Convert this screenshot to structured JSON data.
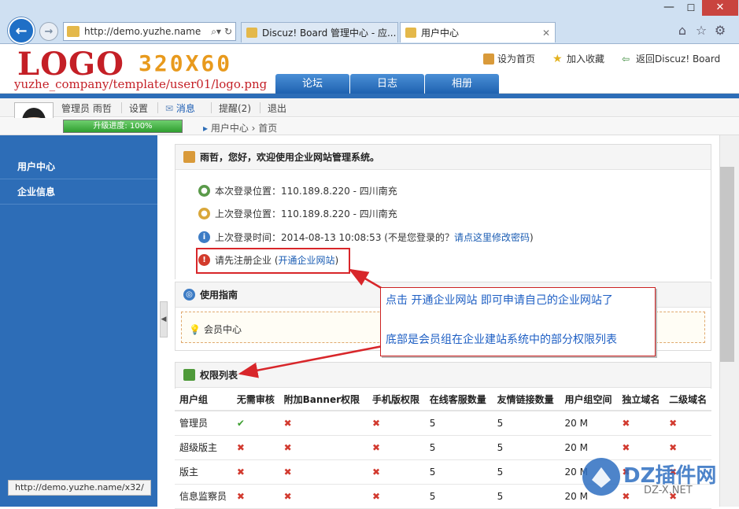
{
  "browser": {
    "url": "http://demo.yuzhe.name",
    "tabs": [
      {
        "label": "Discuz! Board 管理中心 - 应..."
      },
      {
        "label": "用户中心"
      }
    ]
  },
  "header": {
    "logo_text": "LOGO",
    "logo_size": "320X60",
    "logo_path": "yuzhe_company/template/user01/logo.png",
    "links": [
      "设为首页",
      "加入收藏",
      "返回Discuz! Board"
    ],
    "nav": [
      "论坛",
      "日志",
      "相册"
    ]
  },
  "userbar": {
    "name": "管理员 雨哲",
    "items": [
      "设置",
      "消息",
      "提醒(2)",
      "退出"
    ],
    "progress_label": "升级进度: 100%",
    "progress_value": 100
  },
  "breadcrumb": "用户中心 › 首页",
  "sidebar": {
    "items": [
      {
        "label": "用户中心"
      },
      {
        "label": "企业信息"
      }
    ]
  },
  "welcome": {
    "title": "雨哲，您好，欢迎使用企业网站管理系统。",
    "rows": [
      {
        "text": "本次登录位置：110.189.8.220 - 四川南充"
      },
      {
        "text": "上次登录位置：110.189.8.220 - 四川南充"
      },
      {
        "text": "上次登录时间：2014-08-13 10:08:53 (不是您登录的？",
        "link": "请点这里修改密码",
        "tail": ")"
      },
      {
        "text": "请先注册企业 (",
        "link": "开通企业网站",
        "tail": ")"
      }
    ]
  },
  "guide": {
    "title": "使用指南",
    "item": "会员中心"
  },
  "permissions": {
    "title": "权限列表",
    "columns": [
      "用户组",
      "无需审核",
      "附加Banner权限",
      "手机版权限",
      "在线客服数量",
      "友情链接数量",
      "用户组空间",
      "独立域名",
      "二级域名"
    ],
    "rows": [
      [
        "管理员",
        "✔",
        "✖",
        "✖",
        "5",
        "5",
        "20 M",
        "✖",
        "✖"
      ],
      [
        "超级版主",
        "✖",
        "✖",
        "✖",
        "5",
        "5",
        "20 M",
        "✖",
        "✖"
      ],
      [
        "版主",
        "✖",
        "✖",
        "✖",
        "5",
        "5",
        "20 M",
        "✖",
        "✖"
      ],
      [
        "信息监察员",
        "✖",
        "✖",
        "✖",
        "5",
        "5",
        "20 M",
        "✖",
        "✖"
      ]
    ]
  },
  "annotation": {
    "line1": "点击 开通企业网站 即可申请自己的企业网站了",
    "line2": "底部是会员组在企业建站系统中的部分权限列表"
  },
  "status_url": "http://demo.yuzhe.name/x32/",
  "watermark": {
    "text": "DZ插件网",
    "sub": "DZ-X.NET"
  },
  "colors": {
    "brand_blue": "#2d6db7",
    "logo_red": "#c41f26",
    "accent_orange": "#e89a1d",
    "annotation_red": "#d8262a"
  }
}
